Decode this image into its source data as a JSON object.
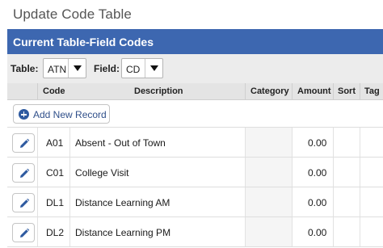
{
  "page": {
    "title": "Update Code Table"
  },
  "panel": {
    "title": "Current Table-Field Codes"
  },
  "filters": {
    "table_label": "Table:",
    "table_value": "ATN",
    "field_label": "Field:",
    "field_value": "CD"
  },
  "columns": [
    "Code",
    "Description",
    "Category",
    "Amount",
    "Sort",
    "Tag"
  ],
  "actions": {
    "add_label": "Add New Record",
    "add_icon": "plus-circle-icon",
    "edit_icon": "pencil-icon"
  },
  "rows": [
    {
      "code": "A01",
      "description": "Absent - Out of Town",
      "category": "",
      "amount": "0.00"
    },
    {
      "code": "C01",
      "description": "College Visit",
      "category": "",
      "amount": "0.00"
    },
    {
      "code": "DL1",
      "description": "Distance Learning AM",
      "category": "",
      "amount": "0.00"
    },
    {
      "code": "DL2",
      "description": "Distance Learning PM",
      "category": "",
      "amount": "0.00"
    }
  ],
  "colors": {
    "header_blue": "#3d67b0",
    "icon_blue": "#2e5aa0"
  }
}
